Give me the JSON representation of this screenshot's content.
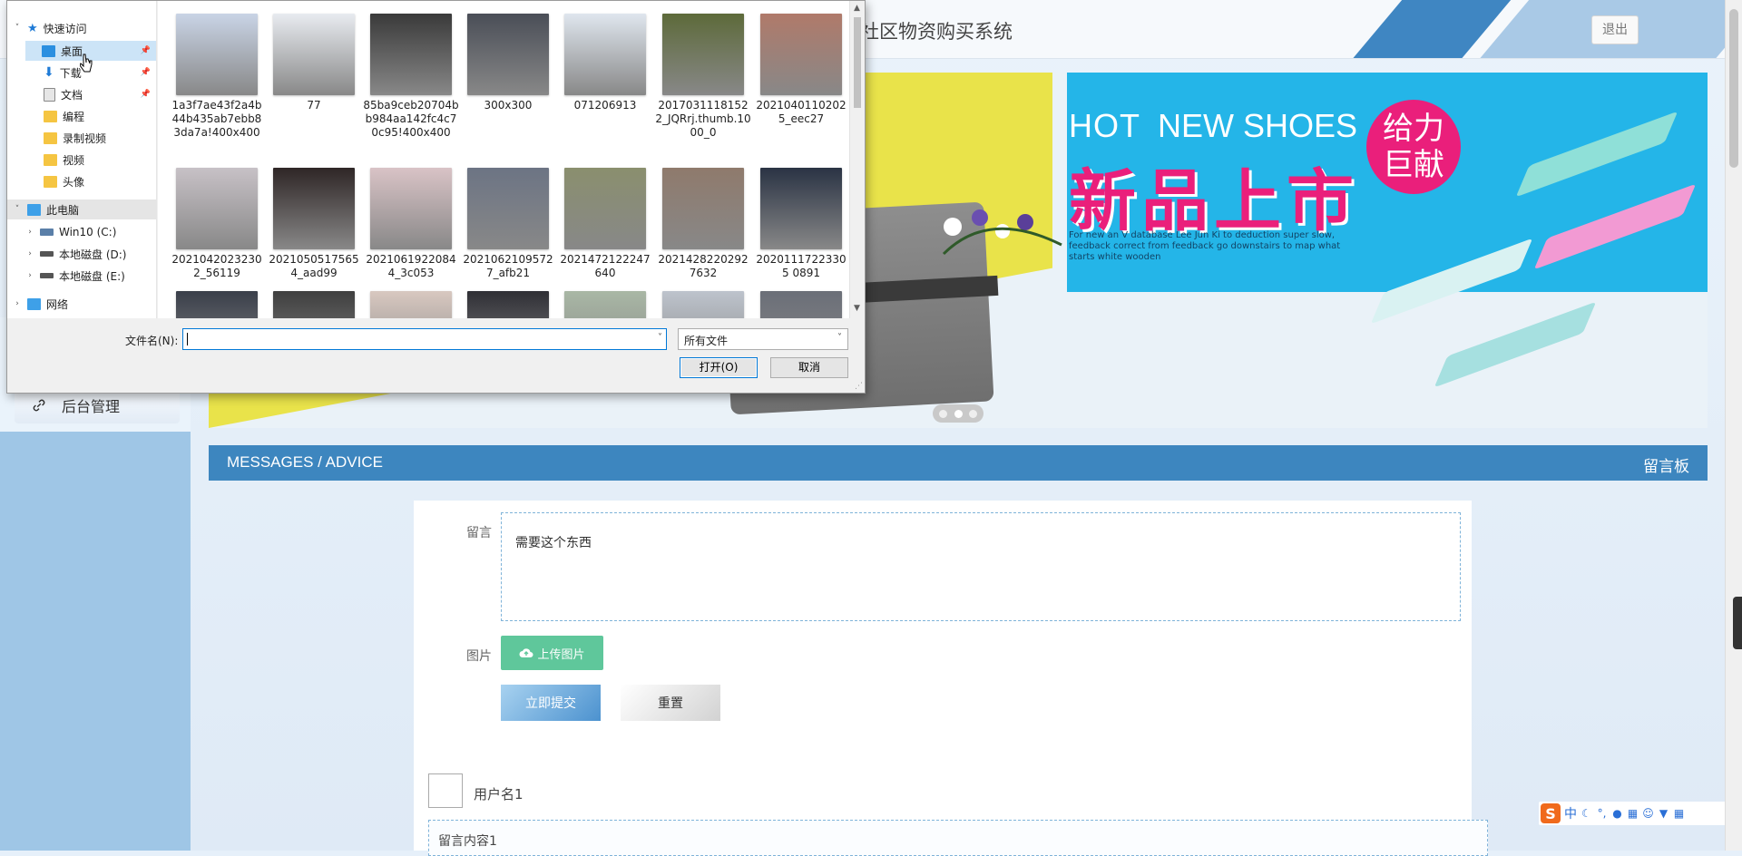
{
  "header": {
    "title": "社区物资购买系统",
    "logout_label": "退出"
  },
  "sidebar": {
    "items": [
      {
        "label": "后台管理",
        "icon": "link-icon"
      }
    ]
  },
  "banner": {
    "hot": "HOT",
    "new_shoes": "NEW SHOES",
    "headline": "新品上市",
    "bubble_line1": "给力",
    "bubble_line2": "巨献",
    "small_text": "For new an V database Lee Jun Ki to deduction super slow, feedback correct from feedback go downstairs to map what starts white wooden",
    "slide_count": 3,
    "active_slide": 1
  },
  "messages_bar": {
    "left": "MESSAGES / ADVICE",
    "right": "留言板"
  },
  "form": {
    "message_label": "留言",
    "message_value": "需要这个东西",
    "image_label": "图片",
    "upload_label": "上传图片",
    "submit_label": "立即提交",
    "reset_label": "重置"
  },
  "comments": [
    {
      "username": "用户名1",
      "content": "留言内容1"
    }
  ],
  "ime": {
    "mode": "中"
  },
  "file_dialog": {
    "tree": [
      {
        "label": "快速访问",
        "icon": "star-icon",
        "type": "section"
      },
      {
        "label": "桌面",
        "icon": "desktop-icon",
        "selected": true,
        "pinned": true
      },
      {
        "label": "下载",
        "icon": "download-icon",
        "pinned": true
      },
      {
        "label": "文档",
        "icon": "document-icon",
        "pinned": true
      },
      {
        "label": "编程",
        "icon": "folder-icon"
      },
      {
        "label": "录制视频",
        "icon": "folder-icon"
      },
      {
        "label": "视频",
        "icon": "folder-icon"
      },
      {
        "label": "头像",
        "icon": "folder-icon"
      },
      {
        "label": "此电脑",
        "icon": "computer-icon",
        "type": "section"
      },
      {
        "label": "Win10 (C:)",
        "icon": "drive-icon"
      },
      {
        "label": "本地磁盘 (D:)",
        "icon": "drive-icon"
      },
      {
        "label": "本地磁盘 (E:)",
        "icon": "drive-icon"
      },
      {
        "label": "网络",
        "icon": "network-icon"
      }
    ],
    "files_row1": [
      {
        "name": "1a3f7ae43f2a4b44b435ab7ebb83da7a!400x400",
        "color": "#c9d4e6"
      },
      {
        "name": "77",
        "color": "#e8ebf0"
      },
      {
        "name": "85ba9ceb20704bb984aa142fc4c70c95!400x400",
        "color": "#3a3a3a"
      },
      {
        "name": "300x300",
        "color": "#4a4e57"
      },
      {
        "name": "071206913",
        "color": "#dfe6ee"
      },
      {
        "name": "20170311181522_JQRrj.thumb.1000_0",
        "color": "#5d6a3a"
      },
      {
        "name": "20210401102025_eec27",
        "color": "#b07a6a"
      }
    ],
    "files_row2": [
      {
        "name": "20210420232302_56119",
        "color": "#c7c1c6"
      },
      {
        "name": "20210505175654_aad99",
        "color": "#2e2626"
      },
      {
        "name": "20210619220844_3c053",
        "color": "#d9c3c6"
      },
      {
        "name": "20210621095727_afb21",
        "color": "#6c7484"
      },
      {
        "name": "2021472122247640",
        "color": "#8a8f6e"
      },
      {
        "name": "20214282202927632",
        "color": "#8f7a6c"
      },
      {
        "name": "20201117223305 0891",
        "color": "#2a3344"
      }
    ],
    "files_row3_colors": [
      "#3a3f4a",
      "#3f3f3f",
      "#d8c8c0",
      "#2f2f35",
      "#a9b7a5",
      "#bdc3cc",
      "#6b6f78"
    ],
    "filename_label": "文件名(N):",
    "filename_value": "",
    "filetype_value": "所有文件",
    "open_label": "打开(O)",
    "cancel_label": "取消"
  }
}
